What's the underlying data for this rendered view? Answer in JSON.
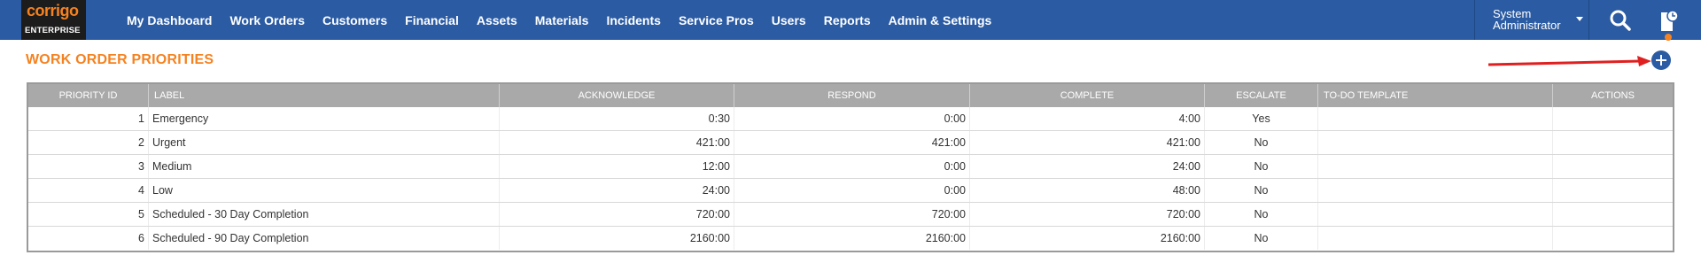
{
  "app": {
    "logo_brand": "corrigo",
    "logo_sub": "ENTERPRISE"
  },
  "nav": {
    "items": [
      {
        "label": "My Dashboard"
      },
      {
        "label": "Work Orders"
      },
      {
        "label": "Customers"
      },
      {
        "label": "Financial"
      },
      {
        "label": "Assets"
      },
      {
        "label": "Materials"
      },
      {
        "label": "Incidents"
      },
      {
        "label": "Service Pros"
      },
      {
        "label": "Users"
      },
      {
        "label": "Reports"
      },
      {
        "label": "Admin & Settings"
      }
    ]
  },
  "user": {
    "name": "System Administrator"
  },
  "icons": {
    "search": "search-icon",
    "doc": "document-clock-icon",
    "add": "plus-circle-icon",
    "dropdown": "caret-down-icon"
  },
  "colors": {
    "topbar": "#2b5ba3",
    "accent": "#f58220",
    "header_bg": "#a9a9a9",
    "annotation_arrow": "#e02020"
  },
  "page": {
    "title": "WORK ORDER PRIORITIES"
  },
  "table": {
    "columns": [
      "PRIORITY ID",
      "LABEL",
      "ACKNOWLEDGE",
      "RESPOND",
      "COMPLETE",
      "ESCALATE",
      "TO-DO TEMPLATE",
      "ACTIONS"
    ],
    "rows": [
      {
        "id": "1",
        "label": "Emergency",
        "acknowledge": "0:30",
        "respond": "0:00",
        "complete": "4:00",
        "escalate": "Yes",
        "todo": "",
        "actions": ""
      },
      {
        "id": "2",
        "label": "Urgent",
        "acknowledge": "421:00",
        "respond": "421:00",
        "complete": "421:00",
        "escalate": "No",
        "todo": "",
        "actions": ""
      },
      {
        "id": "3",
        "label": "Medium",
        "acknowledge": "12:00",
        "respond": "0:00",
        "complete": "24:00",
        "escalate": "No",
        "todo": "",
        "actions": ""
      },
      {
        "id": "4",
        "label": "Low",
        "acknowledge": "24:00",
        "respond": "0:00",
        "complete": "48:00",
        "escalate": "No",
        "todo": "",
        "actions": ""
      },
      {
        "id": "5",
        "label": "Scheduled - 30 Day Completion",
        "acknowledge": "720:00",
        "respond": "720:00",
        "complete": "720:00",
        "escalate": "No",
        "todo": "",
        "actions": ""
      },
      {
        "id": "6",
        "label": "Scheduled - 90 Day Completion",
        "acknowledge": "2160:00",
        "respond": "2160:00",
        "complete": "2160:00",
        "escalate": "No",
        "todo": "",
        "actions": ""
      }
    ]
  }
}
